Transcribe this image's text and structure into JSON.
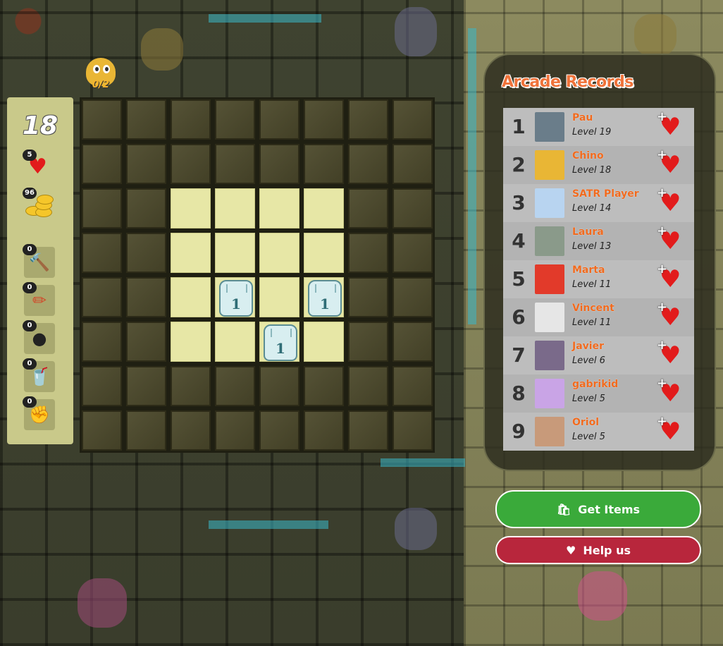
{
  "game": {
    "level": "18",
    "progress": "0/2"
  },
  "stats": {
    "lives": "5",
    "coins": "96",
    "items": [
      {
        "name": "hammer",
        "count": "0",
        "icon": "hammer-icon"
      },
      {
        "name": "pencil",
        "count": "0",
        "icon": "pencil-icon"
      },
      {
        "name": "bomb",
        "count": "0",
        "icon": "bomb-icon"
      },
      {
        "name": "drink",
        "count": "0",
        "icon": "drink-icon"
      },
      {
        "name": "fist",
        "count": "0",
        "icon": "fist-item-icon"
      }
    ]
  },
  "board": {
    "size": 8,
    "open_cells": [
      [
        2,
        2
      ],
      [
        2,
        3
      ],
      [
        2,
        4
      ],
      [
        2,
        5
      ],
      [
        3,
        2
      ],
      [
        3,
        3
      ],
      [
        3,
        4
      ],
      [
        3,
        5
      ],
      [
        4,
        2
      ],
      [
        4,
        3
      ],
      [
        4,
        4
      ],
      [
        4,
        5
      ],
      [
        5,
        2
      ],
      [
        5,
        3
      ],
      [
        5,
        4
      ],
      [
        5,
        5
      ]
    ],
    "numbered_cells": [
      {
        "row": 4,
        "col": 3,
        "value": "1"
      },
      {
        "row": 4,
        "col": 5,
        "value": "1"
      },
      {
        "row": 5,
        "col": 4,
        "value": "1"
      }
    ]
  },
  "records": {
    "title": "Arcade Records",
    "players": [
      {
        "rank": "1",
        "name": "Pau",
        "level": "Level 19",
        "avatar_color": "#6a7d8a"
      },
      {
        "rank": "2",
        "name": "Chino",
        "level": "Level 18",
        "avatar_color": "#e9b635"
      },
      {
        "rank": "3",
        "name": "SATR Player",
        "level": "Level 14",
        "avatar_color": "#b8d4f0"
      },
      {
        "rank": "4",
        "name": "Laura",
        "level": "Level 13",
        "avatar_color": "#8a9a8a"
      },
      {
        "rank": "5",
        "name": "Marta",
        "level": "Level 11",
        "avatar_color": "#e23a2a"
      },
      {
        "rank": "6",
        "name": "Vincent",
        "level": "Level 11",
        "avatar_color": "#e6e6e6"
      },
      {
        "rank": "7",
        "name": "Javier",
        "level": "Level 6",
        "avatar_color": "#7a6a8a"
      },
      {
        "rank": "8",
        "name": "gabrikid",
        "level": "Level 5",
        "avatar_color": "#c9a4e6"
      },
      {
        "rank": "9",
        "name": "Oriol",
        "level": "Level 5",
        "avatar_color": "#c89a7a"
      }
    ]
  },
  "buttons": {
    "get_items": "Get Items",
    "help_us": "Help us"
  },
  "colors": {
    "accent_orange": "#f06a1e",
    "heart_red": "#e21b1b",
    "green_button": "#3aaa3a",
    "red_button": "#b8263c"
  }
}
